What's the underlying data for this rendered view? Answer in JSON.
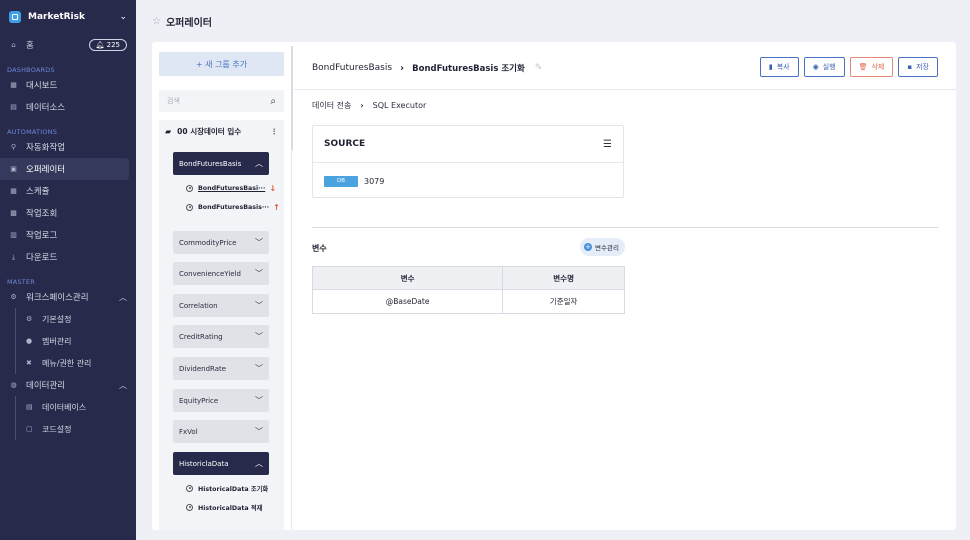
{
  "app": {
    "name": "MarketRisk"
  },
  "sidebar": {
    "home": {
      "label": "홈",
      "badge": "225"
    },
    "sections": {
      "dashboards": "DASHBOARDS",
      "automations": "AUTOMATIONS",
      "master": "MASTER"
    },
    "dashboards": [
      {
        "label": "대시보드",
        "icon": "dashboard-icon"
      },
      {
        "label": "데이터소스",
        "icon": "datasource-icon"
      }
    ],
    "automations": [
      {
        "label": "자동화작업",
        "icon": "automation-icon"
      },
      {
        "label": "오퍼레이터",
        "icon": "operator-icon",
        "active": true
      },
      {
        "label": "스케쥴",
        "icon": "calendar-icon"
      },
      {
        "label": "작업조회",
        "icon": "job-search-icon"
      },
      {
        "label": "작업로그",
        "icon": "log-icon"
      },
      {
        "label": "다운로드",
        "icon": "download-icon"
      }
    ],
    "master": {
      "workspace": {
        "label": "워크스페이스관리",
        "children": [
          "기본설정",
          "멤버관리",
          "메뉴/권한 관리"
        ]
      },
      "data": {
        "label": "데이터관리",
        "children": [
          "데이터베이스",
          "코드설정"
        ]
      }
    }
  },
  "header": {
    "title": "오퍼레이터"
  },
  "groups": {
    "add_label": "+ 새 그룹 추가",
    "search_placeholder": "검색",
    "folder": "00 시장데이터 입수",
    "items": [
      {
        "label": "BondFuturesBasis",
        "open": true,
        "children": [
          {
            "label": "BondFuturesBasi···",
            "arrow": "↓"
          },
          {
            "label": "BondFuturesBasis···",
            "arrow": "↑"
          }
        ]
      },
      {
        "label": "CommodityPrice"
      },
      {
        "label": "ConvenienceYield"
      },
      {
        "label": "Correlation"
      },
      {
        "label": "CreditRating"
      },
      {
        "label": "DividendRate"
      },
      {
        "label": "EquityPrice"
      },
      {
        "label": "FxVol"
      },
      {
        "label": "HistoriclaData",
        "open": true,
        "children": [
          {
            "label": "HistoricalData 조기화"
          },
          {
            "label": "HistoricalData 적재"
          }
        ]
      }
    ]
  },
  "detail": {
    "crumb_parent": "BondFuturesBasis",
    "crumb_current": "BondFuturesBasis 조기화",
    "actions": {
      "copy": "복사",
      "run": "실행",
      "delete": "삭제",
      "save": "저장"
    },
    "sub_crumb": {
      "from": "데이터 전송",
      "to": "SQL Executor"
    },
    "source": {
      "title": "SOURCE",
      "badge": "DB",
      "value": "3079"
    },
    "variables": {
      "title": "변수",
      "manage_label": "변수관리",
      "columns": [
        "변수",
        "변수명"
      ],
      "rows": [
        [
          "@BaseDate",
          "기준일자"
        ]
      ]
    }
  }
}
